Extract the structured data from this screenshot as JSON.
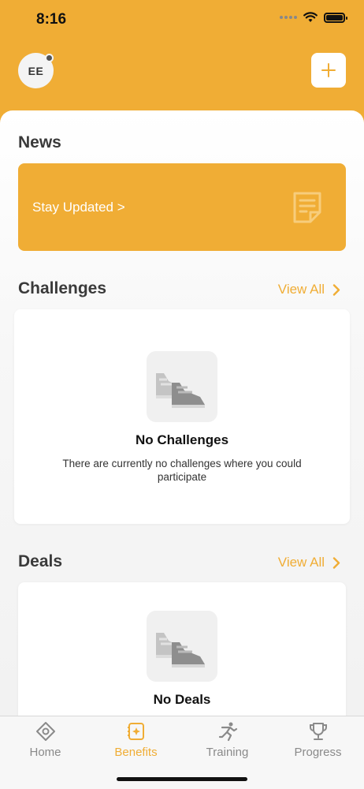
{
  "status_bar": {
    "time": "8:16"
  },
  "header": {
    "avatar_initials": "EE",
    "add_button_icon": "plus-icon"
  },
  "news": {
    "title": "News",
    "card_text": "Stay Updated >",
    "card_icon": "note-icon"
  },
  "challenges": {
    "title": "Challenges",
    "view_all": "View All",
    "empty_title": "No Challenges",
    "empty_description": "There are currently no challenges where you could participate"
  },
  "deals": {
    "title": "Deals",
    "view_all": "View All",
    "empty_title": "No Deals"
  },
  "tabbar": {
    "tabs": [
      {
        "label": "Home",
        "icon": "diamond-icon",
        "active": false
      },
      {
        "label": "Benefits",
        "icon": "benefits-icon",
        "active": true
      },
      {
        "label": "Training",
        "icon": "runner-icon",
        "active": false
      },
      {
        "label": "Progress",
        "icon": "trophy-icon",
        "active": false
      }
    ]
  },
  "colors": {
    "accent": "#f0ad35",
    "inactive": "#8a8a8a"
  }
}
